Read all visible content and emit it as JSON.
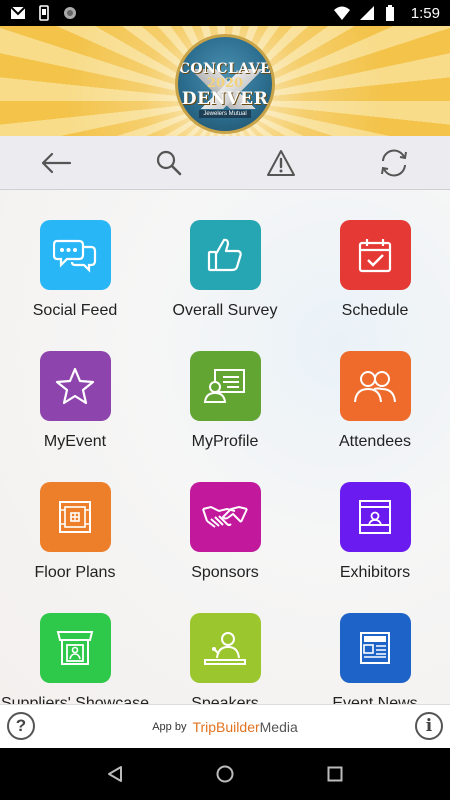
{
  "status_bar": {
    "time": "1:59",
    "left_icons": [
      "gmail-icon",
      "phone-icon",
      "circle-icon"
    ],
    "right_icons": [
      "wifi-icon",
      "signal-icon",
      "battery-icon"
    ]
  },
  "banner": {
    "logo_line1": "CONCLAVE",
    "logo_line2": "2020",
    "logo_line3": "DENVER",
    "logo_sponsor": "Jewelers Mutual"
  },
  "toolbar": {
    "buttons": [
      "back-arrow-icon",
      "search-icon",
      "alert-icon",
      "refresh-icon"
    ]
  },
  "tiles": [
    {
      "label": "Social Feed",
      "icon": "chat-bubbles-icon",
      "color": "#29b6f6"
    },
    {
      "label": "Overall Survey",
      "icon": "thumbs-up-icon",
      "color": "#26a6b3"
    },
    {
      "label": "Schedule",
      "icon": "calendar-check-icon",
      "color": "#e53935"
    },
    {
      "label": "MyEvent",
      "icon": "star-icon",
      "color": "#8e44ad"
    },
    {
      "label": "MyProfile",
      "icon": "profile-card-icon",
      "color": "#63a533"
    },
    {
      "label": "Attendees",
      "icon": "people-icon",
      "color": "#ee6b2c"
    },
    {
      "label": "Floor Plans",
      "icon": "floor-plan-icon",
      "color": "#ee7f2a"
    },
    {
      "label": "Sponsors",
      "icon": "handshake-icon",
      "color": "#c2189c"
    },
    {
      "label": "Exhibitors",
      "icon": "booth-icon",
      "color": "#6a1bf0"
    },
    {
      "label": "Suppliers' Showcase",
      "icon": "shop-icon",
      "color": "#2ec84a"
    },
    {
      "label": "Speakers",
      "icon": "speaker-icon",
      "color": "#9bc62e"
    },
    {
      "label": "Event News",
      "icon": "newspaper-icon",
      "color": "#1e63c8"
    }
  ],
  "footer": {
    "help": "?",
    "app_by": "App by",
    "brand_part1": "TripBuilder",
    "brand_part2": "Media",
    "info": "i"
  },
  "nav_bar": {
    "buttons": [
      "back-triangle-icon",
      "home-circle-icon",
      "recents-square-icon"
    ]
  }
}
